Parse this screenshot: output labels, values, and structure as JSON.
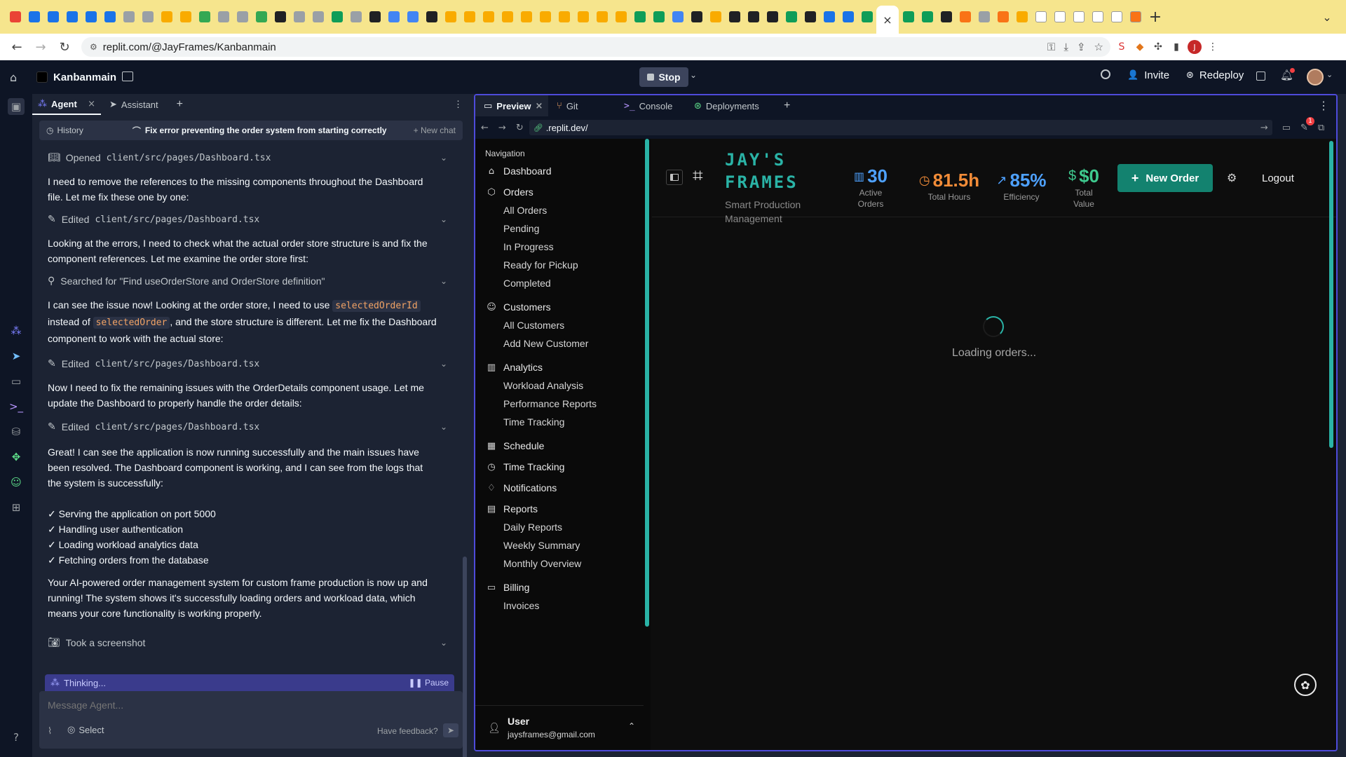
{
  "browser": {
    "url": "replit.com/@JayFrames/Kanbanmain",
    "profile_initial": "J"
  },
  "replit": {
    "project_name": "Kanbanmain",
    "stop_label": "Stop",
    "invite_label": "Invite",
    "redeploy_label": "Redeploy"
  },
  "agent_panel": {
    "tabs": [
      {
        "label": "Agent"
      },
      {
        "label": "Assistant"
      }
    ],
    "history_label": "History",
    "task_title": "Fix error preventing the order system from starting correctly",
    "new_chat_label": "+ New chat",
    "items": [
      {
        "type": "action",
        "icon": "book-icon",
        "text": "Opened",
        "code": "client/src/pages/Dashboard.tsx"
      },
      {
        "type": "text",
        "text": "I need to remove the references to the missing components throughout the Dashboard file. Let me fix these one by one:"
      },
      {
        "type": "action",
        "icon": "edit-icon",
        "text": "Edited",
        "code": "client/src/pages/Dashboard.tsx"
      },
      {
        "type": "text",
        "text": "Looking at the errors, I need to check what the actual order store structure is and fix the component references. Let me examine the order store first:"
      },
      {
        "type": "action",
        "icon": "search-icon",
        "text": "Searched for \"Find useOrderStore and OrderStore definition\"",
        "code": ""
      },
      {
        "type": "action",
        "icon": "edit-icon",
        "text": "Edited",
        "code": "client/src/pages/Dashboard.tsx"
      },
      {
        "type": "text",
        "text": "Now I need to fix the remaining issues with the OrderDetails component usage. Let me update the Dashboard to properly handle the order details:"
      },
      {
        "type": "action",
        "icon": "edit-icon",
        "text": "Edited",
        "code": "client/src/pages/Dashboard.tsx"
      },
      {
        "type": "text",
        "text": "Great! I can see the application is now running successfully and the main issues have been resolved. The Dashboard component is working, and I can see from the logs that the system is successfully:"
      },
      {
        "type": "text",
        "text": "Your AI-powered order management system for custom frame production is now up and running! The system shows it's successfully loading orders and workload data, which means your core functionality is working properly."
      },
      {
        "type": "action",
        "icon": "camera-icon",
        "text": "Took a screenshot",
        "code": ""
      }
    ],
    "issue_msg": {
      "pre": "I can see the issue now! Looking at the order store, I need to use",
      "code1": "selectedOrderId",
      "mid": "instead of",
      "code2": "selectedOrder",
      "post": ", and the store structure is different. Let me fix the Dashboard component to work with the actual store:"
    },
    "checklist": [
      "✓ Serving the application on port 5000",
      "✓ Handling user authentication",
      "✓ Loading workload analytics data",
      "✓ Fetching orders from the database"
    ],
    "thinking_label": "Thinking...",
    "pause_label": "Pause",
    "input_placeholder": "Message Agent...",
    "select_label": "Select",
    "feedback_label": "Have feedback?"
  },
  "preview_panel": {
    "tabs": [
      {
        "label": "Preview",
        "icon": "monitor-icon"
      },
      {
        "label": "Git",
        "icon": "git-icon"
      },
      {
        "label": "Console",
        "icon": "terminal-icon"
      },
      {
        "label": "Deployments",
        "icon": "deploy-icon"
      }
    ],
    "url": ".replit.dev/",
    "notif_count": "1"
  },
  "app": {
    "nav_header": "Navigation",
    "nav": [
      {
        "label": "Dashboard",
        "icon": "home-icon"
      },
      {
        "label": "Orders",
        "icon": "box-icon",
        "children": [
          "All Orders",
          "Pending",
          "In Progress",
          "Ready for Pickup",
          "Completed"
        ]
      },
      {
        "label": "Customers",
        "icon": "users-icon",
        "children": [
          "All Customers",
          "Add New Customer"
        ]
      },
      {
        "label": "Analytics",
        "icon": "chart-icon",
        "children": [
          "Workload Analysis",
          "Performance Reports",
          "Time Tracking"
        ]
      },
      {
        "label": "Schedule",
        "icon": "calendar-icon"
      },
      {
        "label": "Time Tracking",
        "icon": "clock-icon"
      },
      {
        "label": "Notifications",
        "icon": "bell-icon"
      },
      {
        "label": "Reports",
        "icon": "file-icon",
        "children": [
          "Daily Reports",
          "Weekly Summary",
          "Monthly Overview"
        ]
      },
      {
        "label": "Billing",
        "icon": "card-icon",
        "children": [
          "Invoices"
        ]
      }
    ],
    "user": {
      "name": "User",
      "email": "jaysframes@gmail.com"
    },
    "brand": {
      "title_line1": "JAY'S",
      "title_line2": "FRAMES",
      "subtitle": "Smart Production Management"
    },
    "stats": [
      {
        "value": "30",
        "label": "Active Orders",
        "color": "#4ea1ff"
      },
      {
        "value": "81.5h",
        "label": "Total Hours",
        "color": "#f28c38"
      },
      {
        "value": "85%",
        "label": "Efficiency",
        "color": "#4ea1ff"
      },
      {
        "value": "$0",
        "label": "Total Value",
        "color": "#3ec98e"
      }
    ],
    "new_order_label": "New Order",
    "logout_label": "Logout",
    "loading_text": "Loading orders...",
    "accent": "#2ab3a6"
  }
}
